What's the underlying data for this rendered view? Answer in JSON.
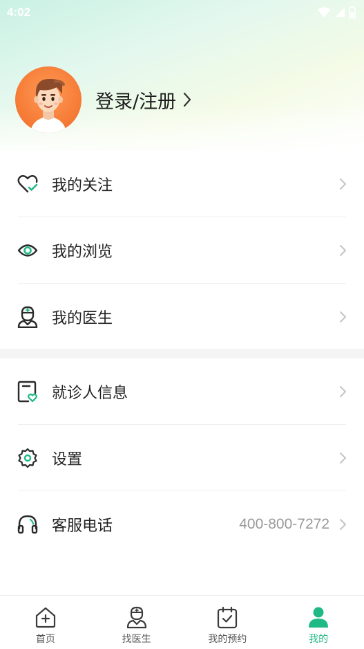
{
  "status_bar": {
    "time": "4:02"
  },
  "profile": {
    "login_label": "登录/注册"
  },
  "menu": {
    "group1": [
      {
        "label": "我的关注",
        "icon": "heart-check-icon"
      },
      {
        "label": "我的浏览",
        "icon": "eye-icon"
      },
      {
        "label": "我的医生",
        "icon": "doctor-icon"
      }
    ],
    "group2": [
      {
        "label": "就诊人信息",
        "icon": "patient-card-icon"
      },
      {
        "label": "设置",
        "icon": "gear-icon"
      },
      {
        "label": "客服电话",
        "icon": "headset-icon",
        "value": "400-800-7272"
      }
    ]
  },
  "tabbar": {
    "items": [
      {
        "label": "首页",
        "icon": "home-plus-icon",
        "active": false
      },
      {
        "label": "找医生",
        "icon": "find-doctor-icon",
        "active": false
      },
      {
        "label": "我的预约",
        "icon": "calendar-check-icon",
        "active": false
      },
      {
        "label": "我的",
        "icon": "user-icon",
        "active": true
      }
    ]
  },
  "colors": {
    "accent": "#1fb985",
    "icon_dark": "#2a2a2a",
    "divider": "#f4f4f4"
  }
}
